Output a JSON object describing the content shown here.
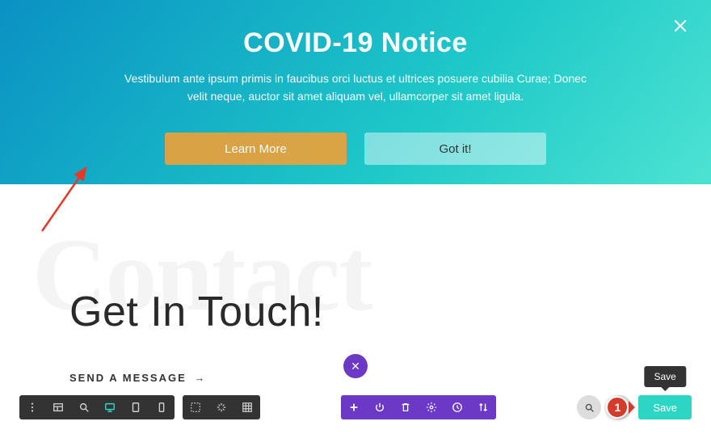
{
  "banner": {
    "title": "COVID-19 Notice",
    "body": "Vestibulum ante ipsum primis in faucibus orci luctus et ultrices posuere cubilia Curae; Donec velit neque, auctor sit amet aliquam vel, ullamcorper sit amet ligula.",
    "learn_label": "Learn More",
    "gotit_label": "Got it!"
  },
  "content": {
    "watermark": "Contact",
    "heading": "Get In Touch!",
    "send_label": "SEND A MESSAGE",
    "send_arrow": "→"
  },
  "float_x": "✕",
  "save": {
    "tooltip": "Save",
    "label": "Save"
  },
  "annotation": {
    "badge": "1"
  }
}
